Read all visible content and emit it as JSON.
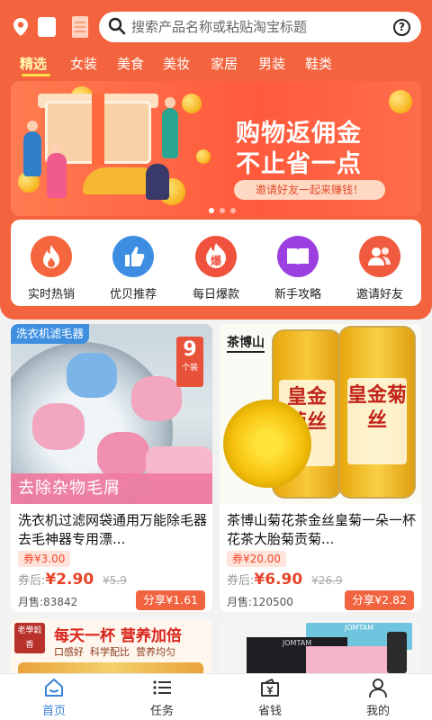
{
  "search": {
    "placeholder": "搜索产品名称或粘贴淘宝标题",
    "help_label": "?"
  },
  "categories": [
    {
      "label": "精选",
      "active": true
    },
    {
      "label": "女装"
    },
    {
      "label": "美食"
    },
    {
      "label": "美妆"
    },
    {
      "label": "家居"
    },
    {
      "label": "男装"
    },
    {
      "label": "鞋类"
    }
  ],
  "banner": {
    "line1": "购物返佣金",
    "line2": "不止省一点",
    "pill": "邀请好友一起来赚钱！",
    "slides": 3,
    "current_slide": 1
  },
  "quick_actions": [
    {
      "label": "实时热销",
      "icon": "flame-icon",
      "color": "#f5663f"
    },
    {
      "label": "优贝推荐",
      "icon": "thumbs-up-icon",
      "color": "#3d8ee3"
    },
    {
      "label": "每日爆款",
      "icon": "burst-icon",
      "color": "#f0523e",
      "glyph": "爆"
    },
    {
      "label": "新手攻略",
      "icon": "book-icon",
      "color": "#9b3fe0"
    },
    {
      "label": "邀请好友",
      "icon": "users-icon",
      "color": "#f05a3e"
    }
  ],
  "products": [
    {
      "tag": "洗衣机滤毛器",
      "count_badge": "9",
      "count_unit": "个装",
      "image_caption": "去除杂物毛屑",
      "name": "洗衣机过滤网袋通用万能除毛器去毛神器专用漂...",
      "coupon": "券¥3.00",
      "after_label": "券后:",
      "price": "¥2.90",
      "original_price": "¥5.9",
      "sold": "月售:83842",
      "share": "分享¥1.61"
    },
    {
      "brand": "茶博山",
      "jar_text": "皇金菊丝",
      "name": "茶博山菊花茶金丝皇菊一朵一杯花茶大胎菊贡菊...",
      "coupon": "券¥20.00",
      "after_label": "券后:",
      "price": "¥6.90",
      "original_price": "¥26.9",
      "sold": "月售:120500",
      "share": "分享¥2.82"
    },
    {
      "brand_logo_text": "老學穀香",
      "headline": "每天一杯 营养加倍",
      "subline": "口感好  科学配比  营养均匀"
    },
    {
      "brand_logo_text": "JOMTAM"
    }
  ],
  "bottom_nav": [
    {
      "label": "首页",
      "icon": "home-icon",
      "active": true
    },
    {
      "label": "任务",
      "icon": "list-icon"
    },
    {
      "label": "省钱",
      "icon": "wallet-icon"
    },
    {
      "label": "我的",
      "icon": "user-icon"
    }
  ],
  "colors": {
    "brand": "#f3643e",
    "price": "#e8442a",
    "nav_active": "#3a82d8"
  }
}
